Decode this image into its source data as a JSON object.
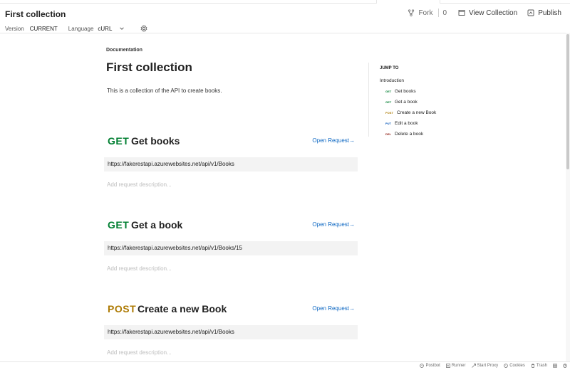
{
  "header": {
    "title": "First collection",
    "fork_label": "Fork",
    "fork_count": "0",
    "view_collection_label": "View Collection",
    "publish_label": "Publish"
  },
  "subbar": {
    "version_label": "Version",
    "version_value": "CURRENT",
    "language_label": "Language",
    "language_value": "cURL"
  },
  "doc": {
    "breadcrumb": "Documentation",
    "title": "First collection",
    "description": "This is a collection of the API to create books."
  },
  "requests": [
    {
      "method": "GET",
      "name": "Get books",
      "url": "https://fakerestapi.azurewebsites.net/api/v1/Books",
      "open_label": "Open Request→",
      "add_desc": "Add request description..."
    },
    {
      "method": "GET",
      "name": "Get a book",
      "url": "https://fakerestapi.azurewebsites.net/api/v1/Books/15",
      "open_label": "Open Request→",
      "add_desc": "Add request description..."
    },
    {
      "method": "POST",
      "name": "Create a new Book",
      "url": "https://fakerestapi.azurewebsites.net/api/v1/Books",
      "open_label": "Open Request→",
      "add_desc": "Add request description..."
    }
  ],
  "jump": {
    "title": "JUMP TO",
    "intro": "Introduction",
    "items": [
      {
        "method": "GET",
        "label": "Get books"
      },
      {
        "method": "GET",
        "label": "Get a book"
      },
      {
        "method": "POST",
        "label": "Create a new Book"
      },
      {
        "method": "PUT",
        "label": "Edit a book"
      },
      {
        "method": "DEL",
        "label": "Delete a book"
      }
    ]
  },
  "statusbar": {
    "postbot": "Postbot",
    "runner": "Runner",
    "proxy": "Start Proxy",
    "cookies": "Cookies",
    "trash": "Trash"
  },
  "colors": {
    "get": "#007f31",
    "post": "#ad7a03",
    "put": "#0053b8",
    "del": "#8e1a10",
    "link": "#0b66c2"
  }
}
